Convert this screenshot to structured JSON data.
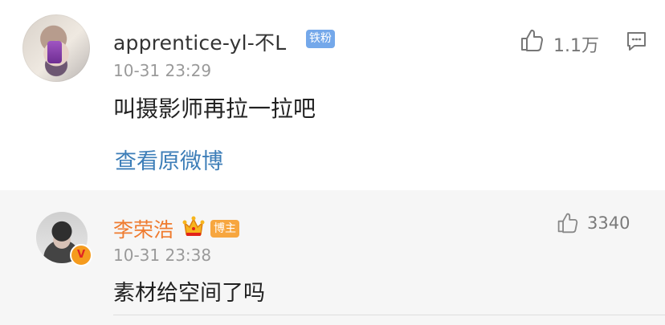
{
  "comments": [
    {
      "username": "apprentice-yl-不L",
      "badge": "铁粉",
      "timestamp": "10-31 23:29",
      "content": "叫摄影师再拉一拉吧",
      "likes": "1.1万",
      "view_original": "查看原微博"
    },
    {
      "username": "李荣浩",
      "badge": "博主",
      "timestamp": "10-31 23:38",
      "content": "素材给空间了吗",
      "likes": "3340",
      "verified_mark": "V"
    }
  ],
  "colors": {
    "link": "#3d7eb8",
    "host_name": "#ef7b2f",
    "fan_badge": "#74a8ea",
    "host_badge": "#f7a63f",
    "reply_background": "#f6f6f6"
  },
  "icons": {
    "like": "thumbs-up-icon",
    "more": "comment-more-icon",
    "crown": "crown-icon",
    "verified": "verified-badge-icon"
  }
}
